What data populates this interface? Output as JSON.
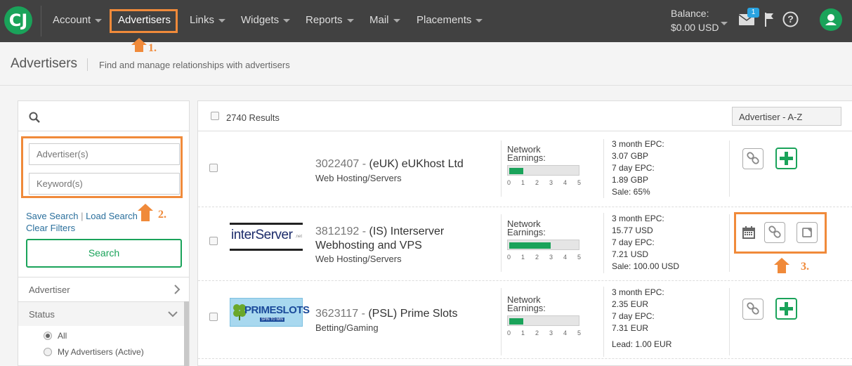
{
  "nav": {
    "logo_letter": "CJ",
    "items": [
      {
        "label": "Account",
        "has_caret": true
      },
      {
        "label": "Advertisers",
        "has_caret": false
      },
      {
        "label": "Links",
        "has_caret": true
      },
      {
        "label": "Widgets",
        "has_caret": true
      },
      {
        "label": "Reports",
        "has_caret": true
      },
      {
        "label": "Mail",
        "has_caret": true
      },
      {
        "label": "Placements",
        "has_caret": true
      }
    ],
    "balance_label": "Balance:",
    "balance_value": "$0.00 USD",
    "mail_badge": "1"
  },
  "annotations": {
    "one": "1.",
    "two": "2.",
    "three": "3."
  },
  "header": {
    "title": "Advertisers",
    "subtitle": "Find and manage relationships with advertisers"
  },
  "sidebar": {
    "advertiser_placeholder": "Advertiser(s)",
    "keyword_placeholder": "Keyword(s)",
    "save_search": "Save Search",
    "link_sep": "|",
    "load_search": "Load Search",
    "clear_filters": "Clear Filters",
    "search_button": "Search",
    "filter_advertiser": "Advertiser",
    "filter_status": "Status",
    "status_options": [
      "All",
      "My Advertisers (Active)"
    ]
  },
  "results": {
    "count": "2740 Results",
    "sort": "Advertiser - A-Z",
    "network_earnings_label": "Network Earnings:",
    "scale": [
      "0",
      "1",
      "2",
      "3",
      "4",
      "5"
    ],
    "rows": [
      {
        "id": "3022407",
        "name": "(eUK) eUKhost Ltd",
        "category": "Web Hosting/Servers",
        "earnings_level": 1,
        "epc_lines": [
          "3 month EPC:",
          "3.07 GBP",
          "7 day EPC:",
          "1.89 GBP",
          "Sale: 65%"
        ],
        "logo_text": ""
      },
      {
        "id": "3812192",
        "name": "(IS) Interserver",
        "name_line2": "Webhosting and VPS",
        "category": "Web Hosting/Servers",
        "earnings_level": 3,
        "epc_lines": [
          "3 month EPC:",
          "15.77 USD",
          "7 day EPC:",
          "7.21 USD",
          "Sale: 100.00 USD"
        ],
        "logo_text": "interServer",
        "logo_sub": ".net"
      },
      {
        "id": "3623117",
        "name": "(PSL) Prime Slots",
        "category": "Betting/Gaming",
        "earnings_level": 1,
        "epc_lines": [
          "3 month EPC:",
          "2.35 EUR",
          "7 day EPC:",
          "7.31 EUR",
          "Lead: 1.00 EUR"
        ],
        "logo_text": "PRIMESLOTS",
        "logo_sub": "SPIN TO WIN"
      }
    ]
  },
  "colors": {
    "accent": "#1aa35a",
    "highlight": "#f08a3a",
    "nav_bg": "#414141"
  }
}
